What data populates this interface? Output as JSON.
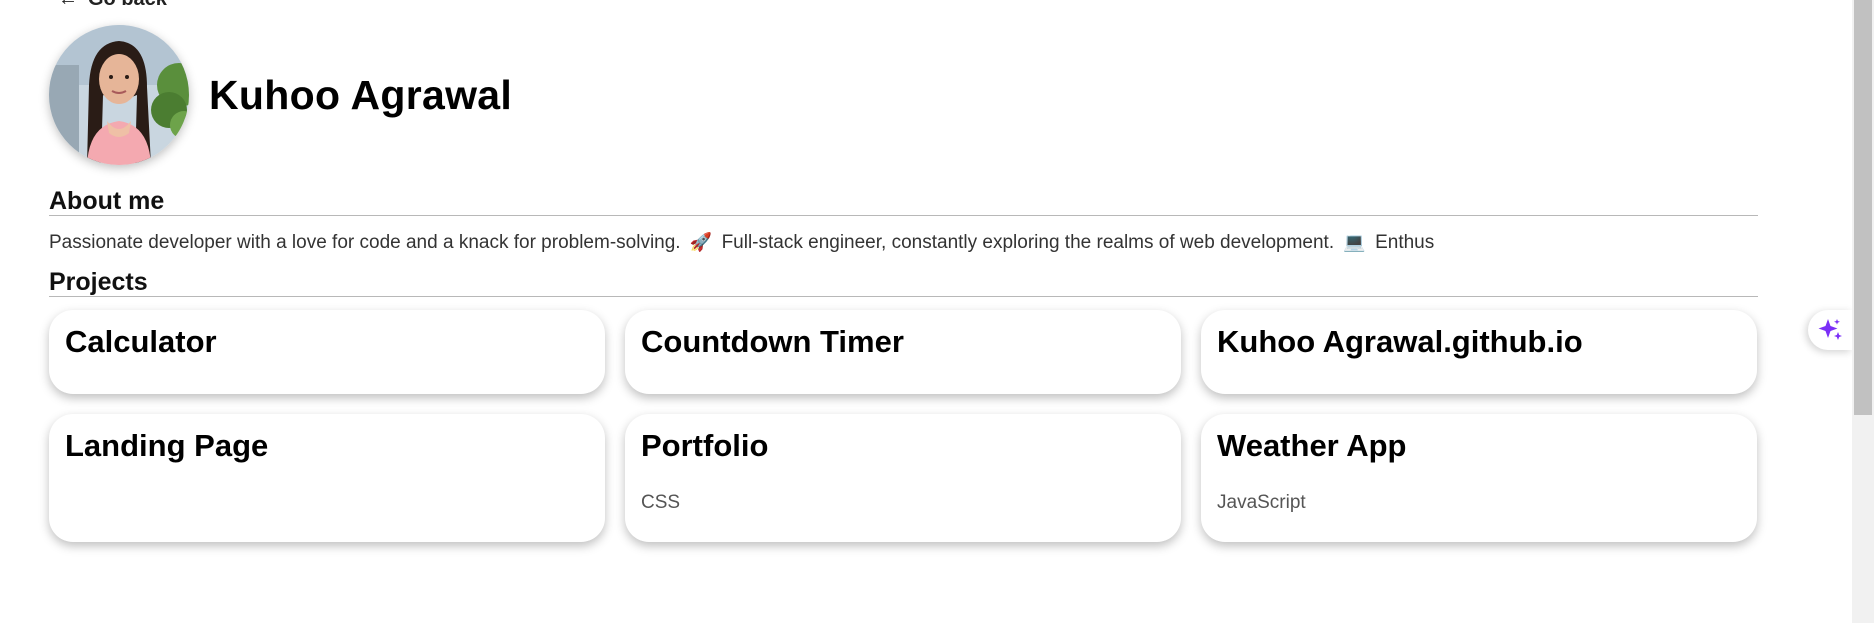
{
  "nav": {
    "back_label": "Go back",
    "back_arrow": "←"
  },
  "profile": {
    "name": "Kuhoo Agrawal"
  },
  "about": {
    "heading": "About me",
    "text_part1": "Passionate developer with a love for code and a knack for problem-solving.",
    "emoji1": "🚀",
    "text_part2": "Full-stack engineer, constantly exploring the realms of web development.",
    "emoji2": "💻",
    "text_part3": "Enthus"
  },
  "projects": {
    "heading": "Projects",
    "items": [
      {
        "title": "Calculator",
        "language": ""
      },
      {
        "title": "Countdown Timer",
        "language": ""
      },
      {
        "title": "Kuhoo Agrawal.github.io",
        "language": ""
      },
      {
        "title": "Landing Page",
        "language": ""
      },
      {
        "title": "Portfolio",
        "language": "CSS"
      },
      {
        "title": "Weather App",
        "language": "JavaScript"
      }
    ]
  },
  "colors": {
    "ai_sparkle": "#7b2ff7",
    "divider": "#b8b8b8"
  },
  "icons": {
    "ai_button": "sparkle-icon",
    "back": "arrow-left-icon"
  }
}
